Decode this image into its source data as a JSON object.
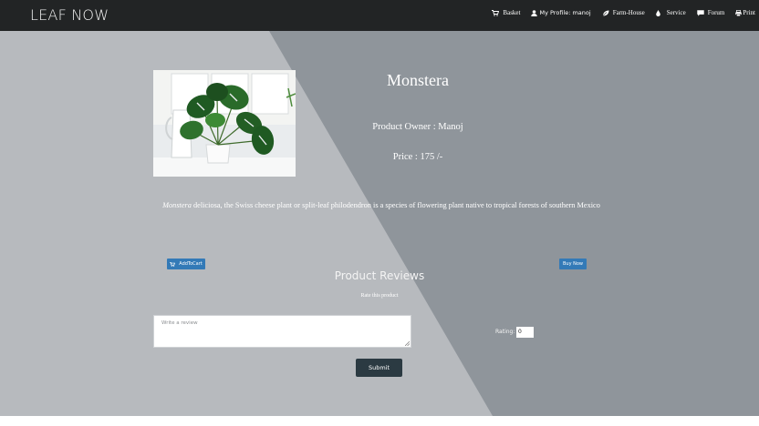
{
  "navbar": {
    "brand": "LEAF NOW",
    "items": [
      {
        "label": "Basket",
        "icon": "cart-icon"
      },
      {
        "label": "My Profile: manoj",
        "icon": "user-icon"
      },
      {
        "label": "Farm-House",
        "icon": "leaf-icon"
      },
      {
        "label": "Service",
        "icon": "drop-icon"
      },
      {
        "label": "Forum",
        "icon": "comment-icon"
      },
      {
        "label": "Print",
        "icon": "print-icon"
      }
    ]
  },
  "product": {
    "image_alt": "Monstera plant in a white pot",
    "name": "Monstera",
    "owner": "Product Owner : Manoj",
    "price": "Price : 175 /-",
    "description_italic": "Monstera",
    "description_rest": " deliciosa, the Swiss cheese plant or split-leaf philodendron is a species of flowering plant native to tropical forests of southern Mexico"
  },
  "actions": {
    "add_to_cart": "AddToCart",
    "buy_now": "Buy Now"
  },
  "reviews": {
    "heading": "Product Reviews",
    "rate_prompt": "Rate this product",
    "placeholder": "Write a review",
    "rating_label": "Rating:",
    "rating_value": "0",
    "submit": "Submit"
  },
  "colors": {
    "navbar": "#222425",
    "panel_light": "#b7babe",
    "panel_dark": "#8f959b",
    "button_blue": "#337ab7",
    "submit_dark": "#2b3a42"
  }
}
